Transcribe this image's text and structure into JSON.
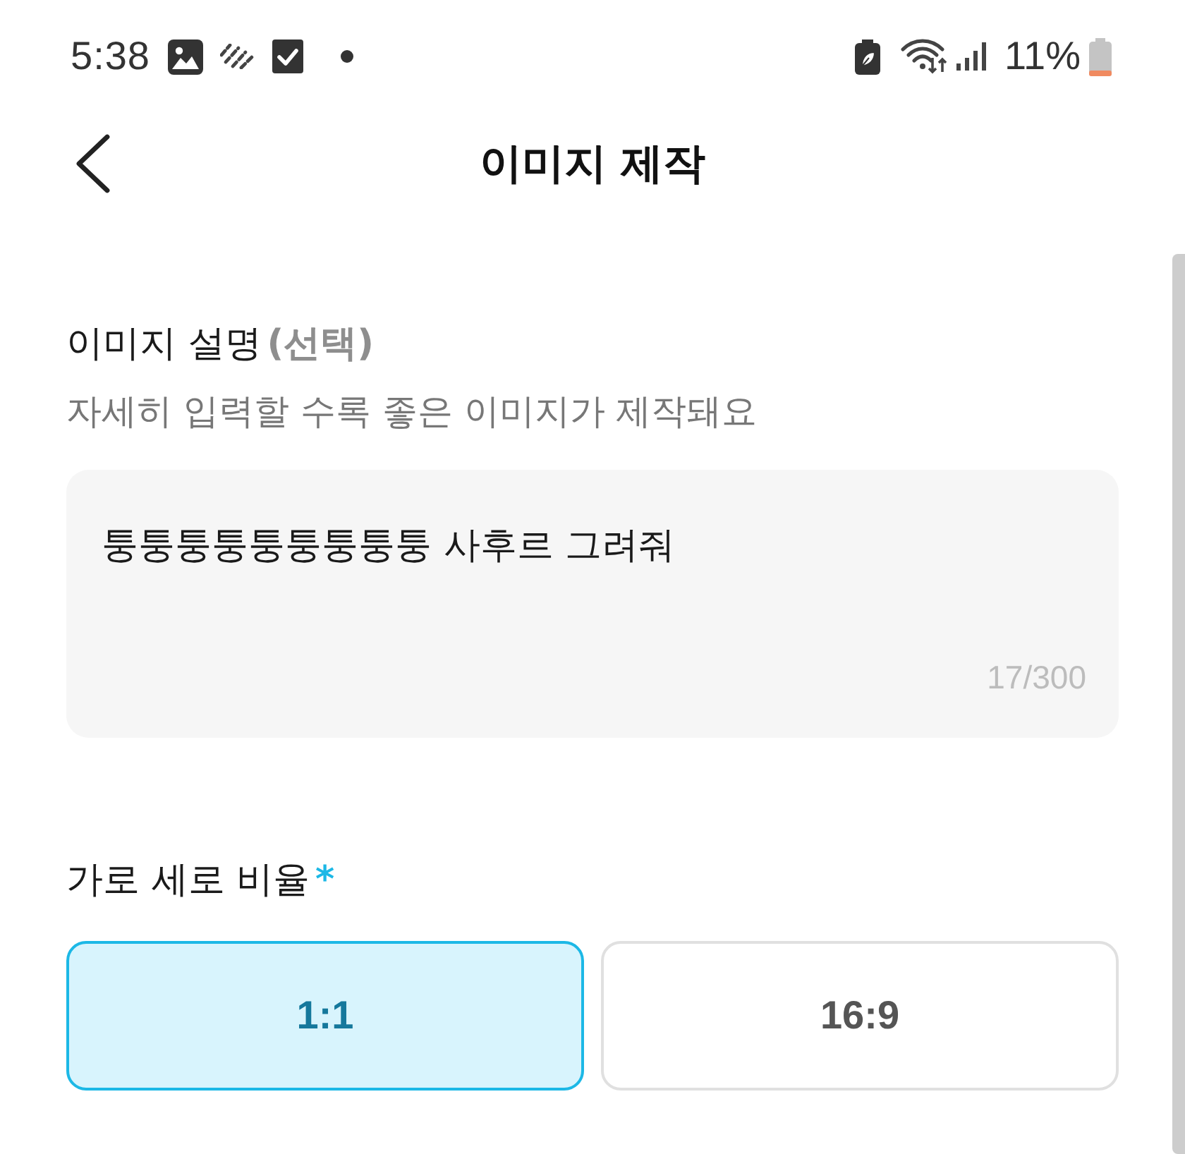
{
  "status_bar": {
    "time": "5:38",
    "battery": "11%"
  },
  "header": {
    "title": "이미지 제작"
  },
  "description": {
    "label": "이미지 설명",
    "optional_tag": "(선택)",
    "hint": "자세히 입력할 수록 좋은 이미지가 제작돼요",
    "value": "퉁퉁퉁퉁퉁퉁퉁퉁퉁 사후르 그려줘",
    "counter": "17/300"
  },
  "aspect_ratio": {
    "label": "가로 세로 비율",
    "required_mark": "*",
    "options": [
      {
        "label": "1:1",
        "selected": true
      },
      {
        "label": "16:9",
        "selected": false
      }
    ]
  }
}
